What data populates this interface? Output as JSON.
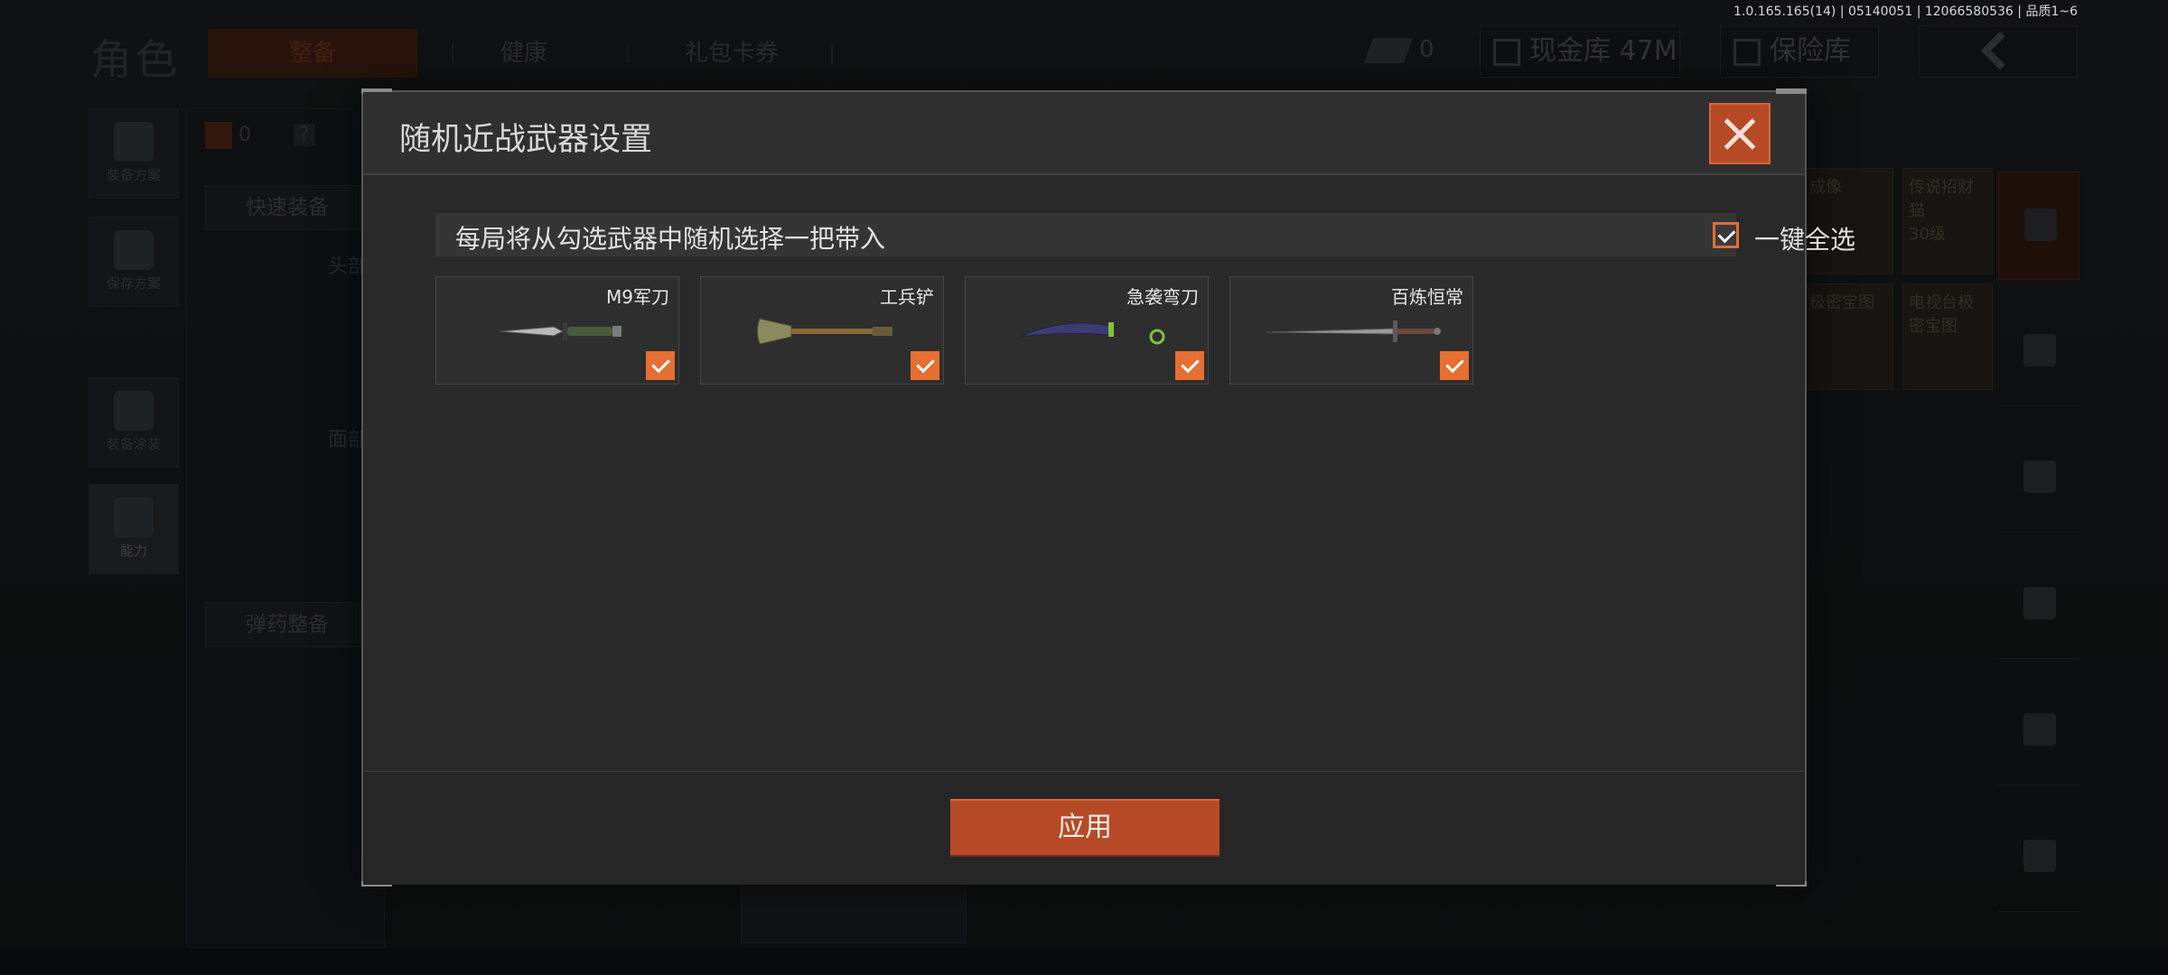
{
  "version_text": "1.0.165.165(14) | 05140051 | 12066580536 | 品质1~6",
  "background": {
    "title": "角色",
    "tabs": [
      "整备",
      "健康",
      "礼包卡券"
    ],
    "currency_value": "0",
    "cash_store_label": "现金库 47M",
    "safe_store_label": "保险库",
    "left_rail": [
      "装备方案",
      "保存方案",
      "装备涂装",
      "能力"
    ],
    "left_panel": {
      "count": "0",
      "help": "?",
      "quick_equip": "快速装备",
      "head_label": "头部",
      "face_label": "面部",
      "ammo_equip": "弹药整备"
    },
    "right_items": [
      "成像",
      "传说招财猫",
      "30级",
      "极密宝图",
      "电视台极密宝图"
    ]
  },
  "modal": {
    "title": "随机近战武器设置",
    "banner_text": "每局将从勾选武器中随机选择一把带入",
    "select_all_label": "一键全选",
    "select_all_checked": true,
    "weapons": [
      {
        "name": "M9军刀",
        "icon": "knife-icon",
        "checked": true
      },
      {
        "name": "工兵铲",
        "icon": "shovel-icon",
        "checked": true
      },
      {
        "name": "急袭弯刀",
        "icon": "karambit-icon",
        "checked": true
      },
      {
        "name": "百炼恒常",
        "icon": "sword-icon",
        "checked": true
      }
    ],
    "apply_label": "应用"
  },
  "colors": {
    "accent": "#e66f33",
    "button": "#b64a27",
    "modal_bg": "#2b2b2b"
  }
}
